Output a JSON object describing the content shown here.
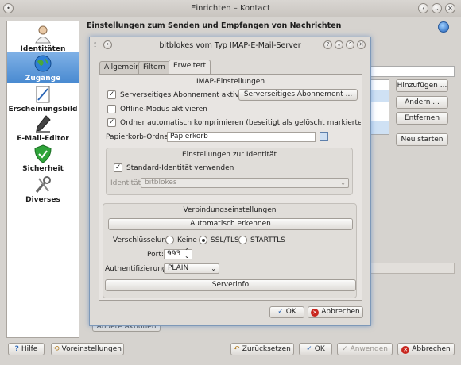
{
  "window": {
    "title": "Einrichten – Kontact"
  },
  "sidebar": {
    "items": [
      {
        "label": "Identitäten",
        "icon": "person-icon"
      },
      {
        "label": "Zugänge",
        "icon": "globe-icon"
      },
      {
        "label": "Erscheinungsbild",
        "icon": "appearance-icon"
      },
      {
        "label": "E-Mail-Editor",
        "icon": "pen-icon"
      },
      {
        "label": "Sicherheit",
        "icon": "shield-icon"
      },
      {
        "label": "Diverses",
        "icon": "tools-icon"
      }
    ]
  },
  "main": {
    "heading": "Einstellungen zum Senden und Empfangen von Nachrichten",
    "buttons": {
      "add": "Hinzufügen ...",
      "change": "Ändern ...",
      "remove": "Entfernen",
      "restart": "Neu starten"
    },
    "other_actions": "Andere Aktionen"
  },
  "dialog": {
    "title": "bitblokes vom Typ IMAP-E-Mail-Server",
    "tabs": [
      "Allgemein",
      "Filtern",
      "Erweitert"
    ],
    "imap": {
      "title": "IMAP-Einstellungen",
      "server_sub_label": "Serverseitiges Abonnement aktivieren",
      "server_sub_button": "Serverseitiges Abonnement ...",
      "offline_label": "Offline-Modus aktivieren",
      "compress_label": "Ordner automatisch komprimieren (beseitigt als gelöscht markierte Nachrichten)",
      "trash_label": "Papierkorb-Ordner:",
      "trash_value": "Papierkorb"
    },
    "identity": {
      "title": "Einstellungen zur Identität",
      "default_label": "Standard-Identität verwenden",
      "identity_label": "Identität:",
      "identity_value": "bitblokes"
    },
    "connection": {
      "title": "Verbindungseinstellungen",
      "auto_detect": "Automatisch erkennen",
      "encryption_label": "Verschlüsselung:",
      "enc_none": "Keine",
      "enc_ssl": "SSL/TLS",
      "enc_starttls": "STARTTLS",
      "port_label": "Port:",
      "port_value": "993",
      "auth_label": "Authentifizierung:",
      "auth_value": "PLAIN",
      "serverinfo": "Serverinfo"
    },
    "ok": "OK",
    "cancel": "Abbrechen"
  },
  "footer": {
    "help": "Hilfe",
    "defaults": "Voreinstellungen",
    "reset": "Zurücksetzen",
    "ok": "OK",
    "apply": "Anwenden",
    "cancel": "Abbrechen"
  }
}
